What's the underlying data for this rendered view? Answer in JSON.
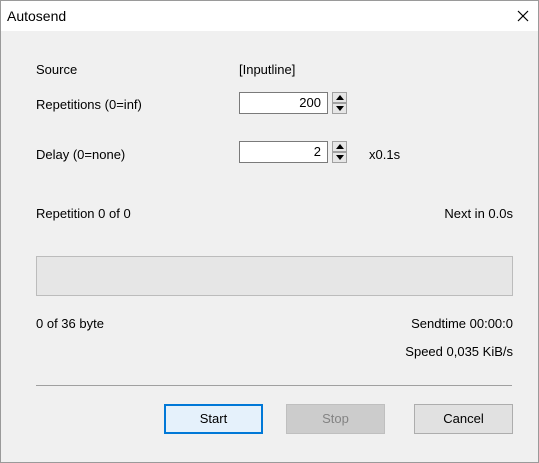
{
  "window": {
    "title": "Autosend"
  },
  "form": {
    "source_label": "Source",
    "source_value": "[Inputline]",
    "repetitions_label": "Repetitions (0=inf)",
    "repetitions_value": "200",
    "delay_label": "Delay (0=none)",
    "delay_value": "2",
    "delay_unit": "x0.1s"
  },
  "status": {
    "repetition_text": "Repetition 0 of 0",
    "next_text": "Next in 0.0s",
    "progress_fraction": 0,
    "bytes_text": "0 of 36 byte",
    "sendtime_text": "Sendtime 00:00:0",
    "speed_text": "Speed 0,035 KiB/s"
  },
  "buttons": {
    "start_label": "Start",
    "stop_label": "Stop",
    "cancel_label": "Cancel"
  },
  "icons": {
    "close": "close-icon",
    "spin_up": "triangle-up-icon",
    "spin_down": "triangle-down-icon"
  },
  "colors": {
    "default_button_border": "#0078d7",
    "dialog_background": "#f0f0f0"
  }
}
